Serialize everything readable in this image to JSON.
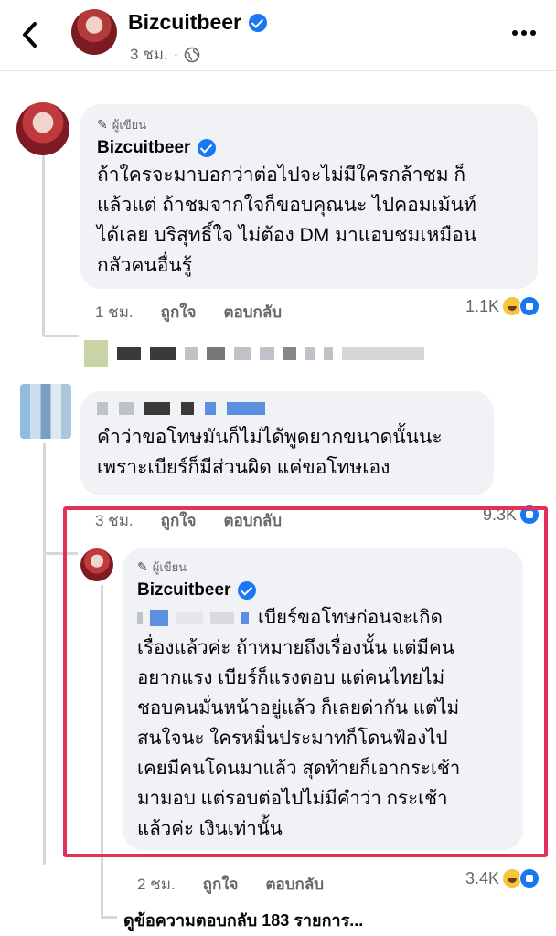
{
  "header": {
    "page_name": "Bizcuitbeer",
    "time": "3 ชม.",
    "icons": [
      "back-icon",
      "verified-icon",
      "globe-icon",
      "more-icon"
    ]
  },
  "comments": [
    {
      "author_tag": "ผู้เขียน",
      "name": "Bizcuitbeer",
      "lines": [
        "ถ้าใครจะมาบอกว่าต่อไปจะไม่มีใครกล้าชม ก็",
        "แล้วแต่ ถ้าชมจากใจก็ขอบคุณนะ ไปคอมเม้นท์",
        "ได้เลย บริสุทธิ์ใจ ไม่ต้อง DM มาแอบชมเหมือน",
        "กลัวคนอื่นรู้"
      ],
      "time": "1 ชม.",
      "like": "ถูกใจ",
      "reply": "ตอบกลับ",
      "reaction_count": "1.1K"
    },
    {
      "lines": [
        "คำว่าขอโทษมันก็ไม่ได้พูดยากขนาดนั้นนะ",
        "เพราะเบียร์ก็มีส่วนผิด แค่ขอโทษเอง"
      ],
      "time": "3 ชม.",
      "like": "ถูกใจ",
      "reply": "ตอบกลับ",
      "reaction_count": "9.3K"
    },
    {
      "author_tag": "ผู้เขียน",
      "name": "Bizcuitbeer",
      "lines": [
        "เบียร์ขอโทษก่อนจะเกิด",
        "เรื่องแล้วค่ะ ถ้าหมายถึงเรื่องนั้น แต่มีคน",
        "อยากแรง เบียร์ก็แรงตอบ แต่คนไทยไม่",
        "ชอบคนมั่นหน้าอยู่แล้ว ก็เลยด่ากัน แต่ไม่",
        "สนใจนะ ใครหมิ่นประมาทก็โดนฟ้องไป",
        "เคยมีคนโดนมาแล้ว สุดท้ายก็เอากระเช้า",
        "มามอบ แต่รอบต่อไปไม่มีคำว่า กระเช้า",
        "แล้วค่ะ เงินเท่านั้น"
      ],
      "time": "2 ชม.",
      "like": "ถูกใจ",
      "reply": "ตอบกลับ",
      "reaction_count": "3.4K"
    }
  ],
  "view_more_replies": "ดูข้อความตอบกลับ 183 รายการ...",
  "colors": {
    "verified": "#1877f2",
    "bubble": "#f0f2f5",
    "highlight": "#e0315a",
    "secondary_text": "#65676b"
  }
}
